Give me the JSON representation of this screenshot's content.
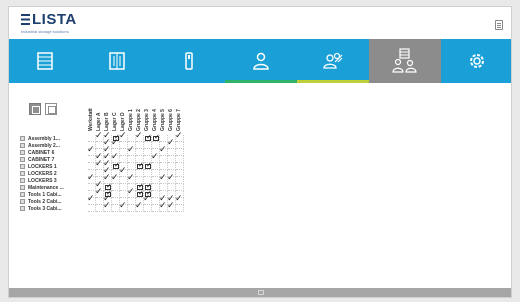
{
  "header": {
    "brand": "LISTA",
    "tagline": "Industrial storage solutions"
  },
  "tabs": [
    {
      "name": "tab-cabinets",
      "icon": "cabinet-icon",
      "underline": ""
    },
    {
      "name": "tab-lockers",
      "icon": "locker-icon",
      "underline": ""
    },
    {
      "name": "tab-key",
      "icon": "key-icon",
      "underline": ""
    },
    {
      "name": "tab-users",
      "icon": "user-icon",
      "underline": "#2fb36a"
    },
    {
      "name": "tab-user-groups",
      "icon": "user-group-icon",
      "underline": "#bfcf3a"
    },
    {
      "name": "tab-access-rights",
      "icon": "access-rights-icon",
      "underline": "",
      "active": true
    },
    {
      "name": "tab-settings",
      "icon": "gear-icon",
      "underline": ""
    }
  ],
  "matrix": {
    "columns": [
      "Werkstatt",
      "Lager A",
      "Lager B",
      "Lager C",
      "Lager D",
      "Gruppe 1",
      "Gruppe 2",
      "Gruppe 3",
      "Gruppe 4",
      "Gruppe 5",
      "Gruppe 6",
      "Gruppe 7"
    ],
    "rows": [
      {
        "label": "Assembly 1...",
        "cells": [
          "",
          "c",
          "c",
          "b",
          "c",
          "",
          "c",
          "b",
          "b",
          "",
          "",
          "c"
        ]
      },
      {
        "label": "Assembly 2...",
        "cells": [
          "",
          "",
          "c",
          "c",
          "",
          "",
          "",
          "",
          "",
          "",
          "c",
          ""
        ]
      },
      {
        "label": "CABINET 6",
        "cells": [
          "c",
          "",
          "c",
          "",
          "",
          "c",
          "",
          "",
          "",
          "c",
          "",
          ""
        ]
      },
      {
        "label": "CABINET 7",
        "cells": [
          "",
          "c",
          "c",
          "c",
          "",
          "",
          "",
          "",
          "c",
          "",
          "",
          ""
        ]
      },
      {
        "label": "LOCKERS 1",
        "cells": [
          "",
          "c",
          "c",
          "b",
          "",
          "",
          "b",
          "b",
          "",
          "",
          "",
          ""
        ]
      },
      {
        "label": "LOCKERS 2",
        "cells": [
          "",
          "",
          "c",
          "",
          "c",
          "",
          "",
          "",
          "",
          "",
          "",
          ""
        ]
      },
      {
        "label": "LOCKERS 3",
        "cells": [
          "c",
          "",
          "c",
          "c",
          "",
          "c",
          "",
          "",
          "",
          "c",
          "c",
          ""
        ]
      },
      {
        "label": "Maintenance ...",
        "cells": [
          "",
          "c",
          "b",
          "",
          "",
          "",
          "b",
          "b",
          "",
          "",
          "",
          ""
        ]
      },
      {
        "label": "Tools 1 Cabi...",
        "cells": [
          "",
          "c",
          "b",
          "",
          "",
          "c",
          "b",
          "b",
          "",
          "",
          "",
          ""
        ]
      },
      {
        "label": "Tools 2 Cabi...",
        "cells": [
          "c",
          "",
          "c",
          "",
          "",
          "",
          "",
          "c",
          "",
          "c",
          "c",
          "c"
        ]
      },
      {
        "label": "Tools 3 Cabi...",
        "cells": [
          "",
          "",
          "c",
          "",
          "c",
          "",
          "c",
          "",
          "",
          "c",
          "c",
          ""
        ]
      }
    ]
  }
}
